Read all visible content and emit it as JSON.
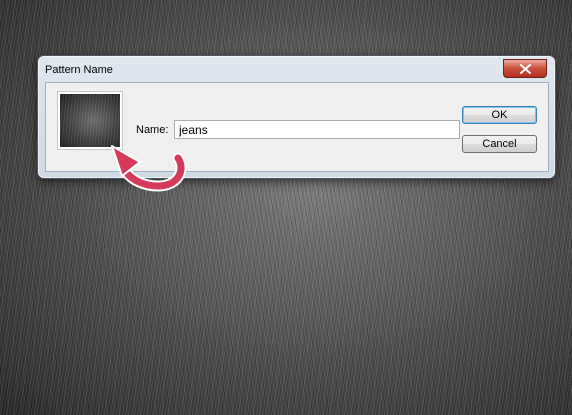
{
  "dialog": {
    "title": "Pattern Name",
    "name_label": "Name:",
    "name_value": "jeans",
    "ok_label": "OK",
    "cancel_label": "Cancel",
    "close_icon": "close-icon"
  },
  "annotation": {
    "arrow_icon": "curved-arrow-icon",
    "arrow_color": "#d63a5a"
  },
  "colors": {
    "close_button": "#c9503b",
    "titlebar": "#dfe7ef"
  }
}
